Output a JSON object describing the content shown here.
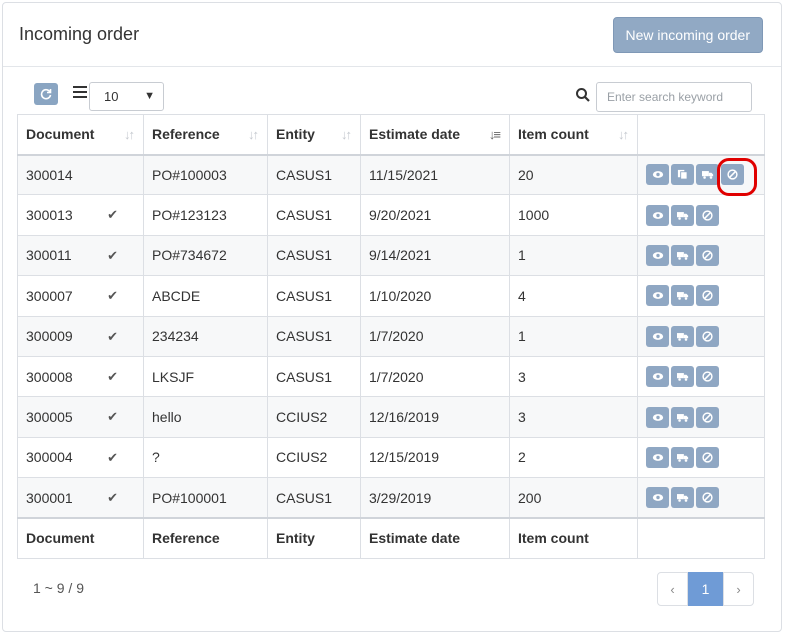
{
  "header": {
    "title": "Incoming order",
    "new_button": "New incoming order"
  },
  "toolbar": {
    "refresh_icon": "refresh-icon",
    "list_icon": "list-icon",
    "page_size": "10",
    "search_icon": "search-icon",
    "search_placeholder": "Enter search keyword"
  },
  "table": {
    "columns": [
      "Document",
      "Reference",
      "Entity",
      "Estimate date",
      "Item count",
      ""
    ],
    "sorted_column": "Estimate date",
    "rows": [
      {
        "document": "300014",
        "confirmed": false,
        "reference": "PO#100003",
        "entity": "CASUS1",
        "estimate_date": "11/15/2021",
        "item_count": "20",
        "actions": [
          "view",
          "copy",
          "truck",
          "cancel"
        ]
      },
      {
        "document": "300013",
        "confirmed": true,
        "reference": "PO#123123",
        "entity": "CASUS1",
        "estimate_date": "9/20/2021",
        "item_count": "1000",
        "actions": [
          "view",
          "truck",
          "cancel"
        ]
      },
      {
        "document": "300011",
        "confirmed": true,
        "reference": "PO#734672",
        "entity": "CASUS1",
        "estimate_date": "9/14/2021",
        "item_count": "1",
        "actions": [
          "view",
          "truck",
          "cancel"
        ]
      },
      {
        "document": "300007",
        "confirmed": true,
        "reference": "ABCDE",
        "entity": "CASUS1",
        "estimate_date": "1/10/2020",
        "item_count": "4",
        "actions": [
          "view",
          "truck",
          "cancel"
        ]
      },
      {
        "document": "300009",
        "confirmed": true,
        "reference": "234234",
        "entity": "CASUS1",
        "estimate_date": "1/7/2020",
        "item_count": "1",
        "actions": [
          "view",
          "truck",
          "cancel"
        ]
      },
      {
        "document": "300008",
        "confirmed": true,
        "reference": "LKSJF",
        "entity": "CASUS1",
        "estimate_date": "1/7/2020",
        "item_count": "3",
        "actions": [
          "view",
          "truck",
          "cancel"
        ]
      },
      {
        "document": "300005",
        "confirmed": true,
        "reference": "hello",
        "entity": "CCIUS2",
        "estimate_date": "12/16/2019",
        "item_count": "3",
        "actions": [
          "view",
          "truck",
          "cancel"
        ]
      },
      {
        "document": "300004",
        "confirmed": true,
        "reference": "?",
        "entity": "CCIUS2",
        "estimate_date": "12/15/2019",
        "item_count": "2",
        "actions": [
          "view",
          "truck",
          "cancel"
        ]
      },
      {
        "document": "300001",
        "confirmed": true,
        "reference": "PO#100001",
        "entity": "CASUS1",
        "estimate_date": "3/29/2019",
        "item_count": "200",
        "actions": [
          "view",
          "truck",
          "cancel"
        ]
      }
    ]
  },
  "footer": {
    "info": "1 ~ 9 / 9",
    "pager": {
      "prev": "‹",
      "current": "1",
      "next": "›"
    }
  },
  "colors": {
    "button": "#91a9c4",
    "action": "#8fa7c3",
    "highlight": "#e00000",
    "active_page": "#6f9bd6"
  }
}
